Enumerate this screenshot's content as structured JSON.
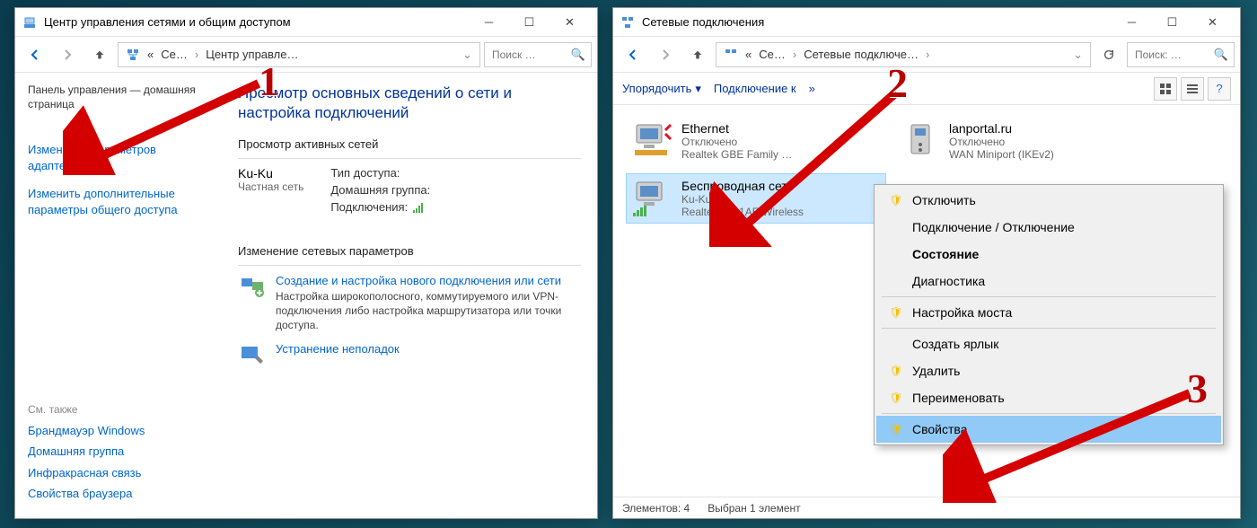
{
  "win1": {
    "title": "Центр управления сетями и общим доступом",
    "breadcrumb": {
      "p0": "«",
      "p1": "Се…",
      "p2": "Центр управле…"
    },
    "search_placeholder": "Поиск …",
    "left": {
      "panel_home": "Панель управления — домашняя страница",
      "adapter_settings": "Изменение параметров адаптера",
      "advanced_sharing": "Изменить дополнительные параметры общего доступа",
      "see_also_title": "См. также",
      "see_also": {
        "firewall": "Брандмауэр Windows",
        "homegroup": "Домашняя группа",
        "infrared": "Инфракрасная связь",
        "browser_props": "Свойства браузера"
      }
    },
    "main": {
      "title": "Просмотр основных сведений о сети и настройка подключений",
      "active_nets": "Просмотр активных сетей",
      "net_name": "Ku-Ku",
      "net_type": "Частная сеть",
      "kv_access": "Тип доступа:",
      "kv_homegroup": "Домашняя группа:",
      "kv_conn": "Подключения:",
      "change_settings": "Изменение сетевых параметров",
      "wiz_new_conn_title": "Создание и настройка нового подключения или сети",
      "wiz_new_conn_desc": "Настройка широкополосного, коммутируемого или VPN-подключения либо настройка маршрутизатора или точки доступа.",
      "wiz_troubleshoot_title": "Устранение неполадок"
    }
  },
  "win2": {
    "title": "Сетевые подключения",
    "breadcrumb": {
      "p0": "«",
      "p1": "Се…",
      "p2": "Сетевые подключе…"
    },
    "search_placeholder": "Поиск: …",
    "toolbar": {
      "organize": "Упорядочить",
      "connect_to": "Подключение к",
      "more": "»"
    },
    "items": [
      {
        "name": "Ethernet",
        "status": "Отключено",
        "device": "Realtek          GBE Family …"
      },
      {
        "name": "lanportal.ru",
        "status": "Отключено",
        "device": "WAN Miniport (IKEv2)"
      },
      {
        "name": "Беспроводная сеть",
        "status": "Ku-Ku",
        "device": "Realtek 8821AE Wireless"
      }
    ],
    "status": {
      "elements": "Элементов: 4",
      "selected": "Выбран 1 элемент"
    },
    "context": {
      "disable": "Отключить",
      "conn_disconn": "Подключение / Отключение",
      "state": "Состояние",
      "diag": "Диагностика",
      "bridge": "Настройка моста",
      "shortcut": "Создать ярлык",
      "delete": "Удалить",
      "rename": "Переименовать",
      "properties": "Свойства"
    }
  },
  "annotations": {
    "n1": "1",
    "n2": "2",
    "n3": "3"
  }
}
